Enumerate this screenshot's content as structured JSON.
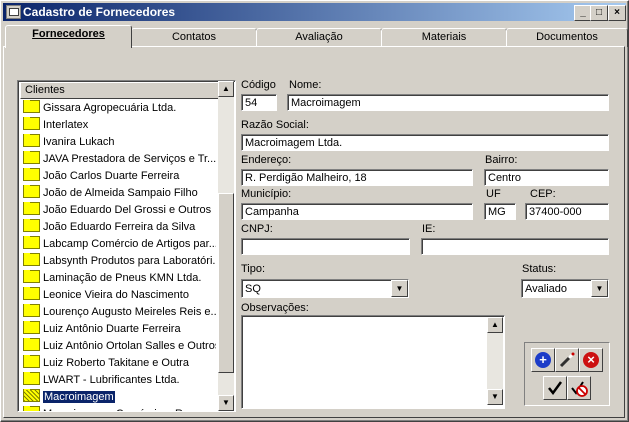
{
  "window": {
    "title": "Cadastro de Fornecedores"
  },
  "tabs": [
    {
      "label": "Fornecedores"
    },
    {
      "label": "Contatos"
    },
    {
      "label": "Avaliação"
    },
    {
      "label": "Materiais"
    },
    {
      "label": "Documentos"
    }
  ],
  "list": {
    "header": "Clientes",
    "items": [
      "Gissara Agropecuária Ltda.",
      "Interlatex",
      "Ivanira Lukach",
      "JAVA Prestadora de Serviços e Tr...",
      "João Carlos Duarte Ferreira",
      "João de Almeida Sampaio Filho",
      "João Eduardo Del Grossi e Outros",
      "João Eduardo Ferreira da Silva",
      "Labcamp Comércio de Artigos par...",
      "Labsynth Produtos para Laboratóri...",
      "Laminação de Pneus KMN Ltda.",
      "Leonice Vieira do Nascimento",
      "Lourenço Augusto Meireles Reis e...",
      "Luiz Antônio Duarte Ferreira",
      "Luiz Antônio Ortolan Salles e Outros",
      "Luiz Roberto Takitane e Outra",
      "LWART - Lubrificantes Ltda.",
      "Macroimagem",
      "Macroimagem Comércio e Representações Ltda."
    ],
    "selected_index": 17
  },
  "form": {
    "codigo_label": "Código",
    "codigo": "54",
    "nome_label": "Nome:",
    "nome": "Macroimagem",
    "razao_label": "Razão Social:",
    "razao": "Macroimagem Ltda.",
    "endereco_label": "Endereço:",
    "endereco": "R. Perdigão Malheiro, 18",
    "bairro_label": "Bairro:",
    "bairro": "Centro",
    "municipio_label": "Município:",
    "municipio": "Campanha",
    "uf_label": "UF",
    "uf": "MG",
    "cep_label": "CEP:",
    "cep": "37400-000",
    "cnpj_label": "CNPJ:",
    "cnpj": "",
    "ie_label": "IE:",
    "ie": "",
    "tipo_label": "Tipo:",
    "tipo": "SQ",
    "status_label": "Status:",
    "status": "Avaliado",
    "obs_label": "Observações:",
    "obs": ""
  },
  "colors": {
    "title_start": "#0a246a",
    "title_end": "#a6caf0",
    "face": "#d4d0c8",
    "selection": "#0a246a"
  }
}
